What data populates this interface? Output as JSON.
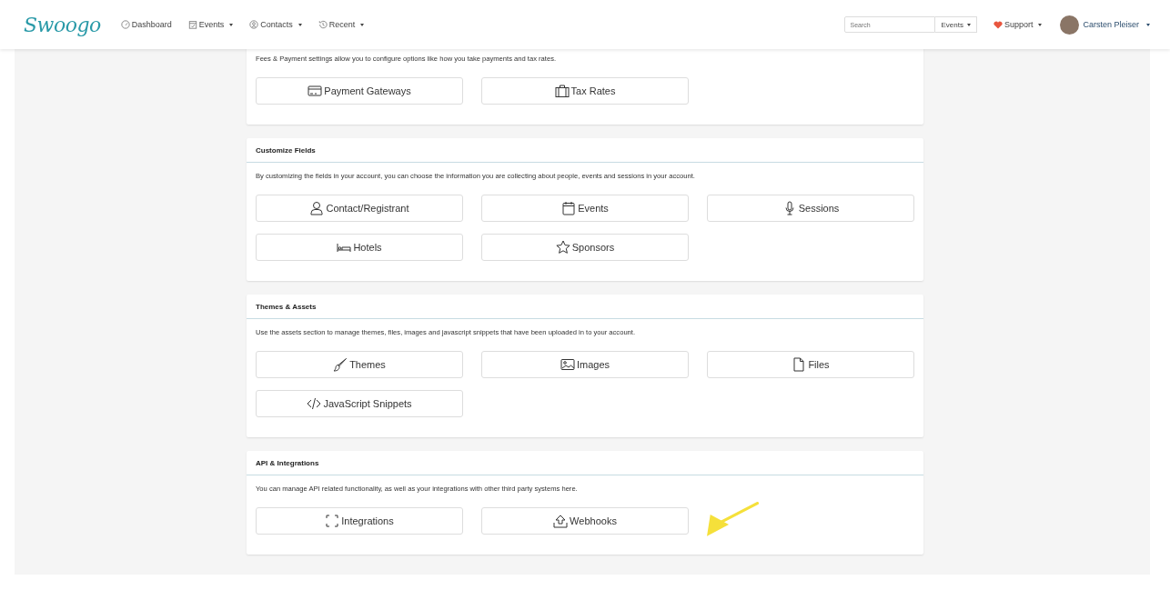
{
  "navbar": {
    "logo": "Swoogo",
    "items": [
      {
        "label": "Dashboard",
        "has_menu": false
      },
      {
        "label": "Events",
        "has_menu": true
      },
      {
        "label": "Contacts",
        "has_menu": true
      },
      {
        "label": "Recent",
        "has_menu": true
      }
    ],
    "search": {
      "placeholder": "Search",
      "scope": "Events"
    },
    "support": "Support",
    "user": "Carsten Pleiser"
  },
  "sections": [
    {
      "description": "Fees & Payment settings allow you to configure options like how you take payments and tax rates.",
      "buttons": [
        "Payment Gateways",
        "Tax Rates"
      ]
    },
    {
      "title": "Customize Fields",
      "description": "By customizing the fields in your account, you can choose the information you are collecting about people, events and sessions in your account.",
      "buttons": [
        "Contact/Registrant",
        "Events",
        "Sessions",
        "Hotels",
        "Sponsors"
      ]
    },
    {
      "title": "Themes & Assets",
      "description": "Use the assets section to manage themes, files, images and javascript snippets that have been uploaded in to your account.",
      "buttons": [
        "Themes",
        "Images",
        "Files",
        "JavaScript Snippets"
      ]
    },
    {
      "title": "API & Integrations",
      "description": "You can manage API related functionality, as well as your integrations with other third party systems here.",
      "buttons": [
        "Integrations",
        "Webhooks"
      ]
    }
  ]
}
